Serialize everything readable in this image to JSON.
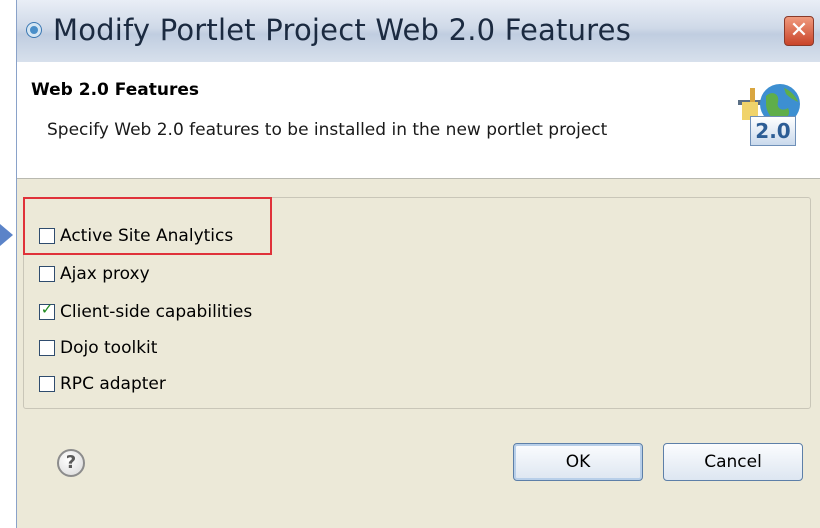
{
  "window": {
    "title": "Modify Portlet Project Web 2.0 Features",
    "close_symbol": "✕"
  },
  "banner": {
    "heading": "Web 2.0 Features",
    "description": "Specify Web 2.0 features to be installed in the new portlet project",
    "icon_name": "web20-features-icon",
    "icon_badge": "2.0"
  },
  "options": [
    {
      "label": "Active Site Analytics",
      "checked": false,
      "highlighted": true
    },
    {
      "label": "Ajax proxy",
      "checked": false,
      "highlighted": false
    },
    {
      "label": "Client-side capabilities",
      "checked": true,
      "highlighted": false
    },
    {
      "label": "Dojo toolkit",
      "checked": false,
      "highlighted": false
    },
    {
      "label": "RPC adapter",
      "checked": false,
      "highlighted": false
    }
  ],
  "footer": {
    "help_symbol": "?",
    "ok_label": "OK",
    "cancel_label": "Cancel"
  },
  "colors": {
    "highlight": "#e0323a",
    "checkmark": "#1e8a1e",
    "pointer_arrow": "#5b83c8"
  }
}
